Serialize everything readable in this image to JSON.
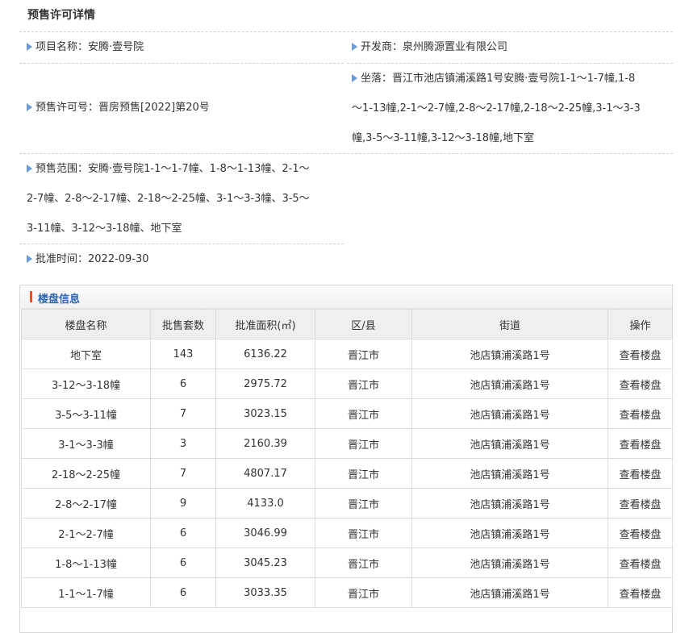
{
  "page": {
    "title": "预售许可详情"
  },
  "info": {
    "project_name": {
      "label": "项目名称：",
      "value": "安腾·壹号院"
    },
    "developer": {
      "label": "开发商：",
      "value": "泉州腾源置业有限公司"
    },
    "permit_no": {
      "label": "预售许可号：",
      "value": "晋房预售[2022]第20号"
    },
    "location": {
      "label": "坐落：",
      "line1": "晋江市池店镇浦溪路1号安腾·壹号院1-1～1-7幢,1-8",
      "line2": "～1-13幢,2-1～2-7幢,2-8～2-17幢,2-18～2-25幢,3-1～3-3",
      "line3": "幢,3-5～3-11幢,3-12～3-18幢,地下室"
    },
    "presale_scope": {
      "label": "预售范围：",
      "line1": "安腾·壹号院1-1～1-7幢、1-8～1-13幢、2-1～",
      "line2": "2-7幢、2-8～2-17幢、2-18～2-25幢、3-1～3-3幢、3-5～",
      "line3": "3-11幢、3-12～3-18幢、地下室"
    },
    "approval_time": {
      "label": "批准时间：",
      "value": "2022-09-30"
    }
  },
  "building_panel": {
    "title": "楼盘信息",
    "headers": [
      "楼盘名称",
      "批售套数",
      "批准面积(㎡)",
      "区/县",
      "街道",
      "操作"
    ],
    "rows": [
      [
        "地下室",
        "143",
        "6136.22",
        "晋江市",
        "池店镇浦溪路1号",
        "查看楼盘"
      ],
      [
        "3-12～3-18幢",
        "6",
        "2975.72",
        "晋江市",
        "池店镇浦溪路1号",
        "查看楼盘"
      ],
      [
        "3-5～3-11幢",
        "7",
        "3023.15",
        "晋江市",
        "池店镇浦溪路1号",
        "查看楼盘"
      ],
      [
        "3-1～3-3幢",
        "3",
        "2160.39",
        "晋江市",
        "池店镇浦溪路1号",
        "查看楼盘"
      ],
      [
        "2-18～2-25幢",
        "7",
        "4807.17",
        "晋江市",
        "池店镇浦溪路1号",
        "查看楼盘"
      ],
      [
        "2-8～2-17幢",
        "9",
        "4133.0",
        "晋江市",
        "池店镇浦溪路1号",
        "查看楼盘"
      ],
      [
        "2-1～2-7幢",
        "6",
        "3046.99",
        "晋江市",
        "池店镇浦溪路1号",
        "查看楼盘"
      ],
      [
        "1-8～1-13幢",
        "6",
        "3045.23",
        "晋江市",
        "池店镇浦溪路1号",
        "查看楼盘"
      ],
      [
        "1-1～1-7幢",
        "6",
        "3033.35",
        "晋江市",
        "池店镇浦溪路1号",
        "查看楼盘"
      ]
    ]
  }
}
